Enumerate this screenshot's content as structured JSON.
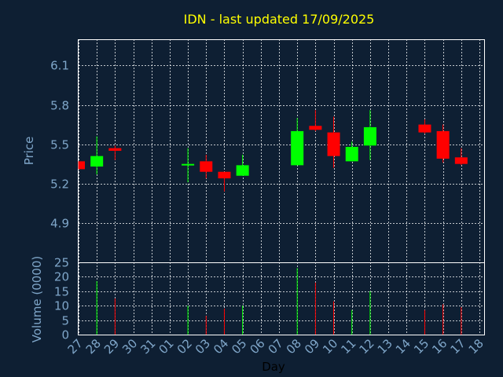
{
  "chart_data": {
    "type": "candlestick",
    "title": "IDN - last updated 17/09/2025",
    "ylabel_price": "Price",
    "ylabel_volume": "Volume (0000)",
    "xlabel": "Day",
    "price_ylim": [
      4.6,
      6.3
    ],
    "price_ticks": [
      "4.9",
      "5.2",
      "5.5",
      "5.8",
      "6.1"
    ],
    "volume_ylim": [
      0,
      25
    ],
    "volume_ticks": [
      "0",
      "5",
      "10",
      "15",
      "20",
      "25"
    ],
    "grid": true,
    "colors": {
      "up": "#00ff00",
      "down": "#ff0000",
      "background": "#0e1f33"
    },
    "days": [
      "27",
      "28",
      "29",
      "30",
      "31",
      "01",
      "02",
      "03",
      "04",
      "05",
      "06",
      "07",
      "08",
      "09",
      "10",
      "11",
      "12",
      "13",
      "14",
      "15",
      "16",
      "17",
      "18"
    ],
    "candles": [
      {
        "day": "27",
        "open": 5.37,
        "high": 5.37,
        "low": 5.31,
        "close": 5.31,
        "volume": 0
      },
      {
        "day": "28",
        "open": 5.33,
        "high": 5.56,
        "low": 5.27,
        "close": 5.41,
        "volume": 18.5
      },
      {
        "day": "29",
        "open": 5.47,
        "high": 5.49,
        "low": 5.38,
        "close": 5.45,
        "volume": 12.5
      },
      {
        "day": "02",
        "open": 5.34,
        "high": 5.47,
        "low": 5.21,
        "close": 5.35,
        "volume": 10
      },
      {
        "day": "03",
        "open": 5.37,
        "high": 5.42,
        "low": 5.24,
        "close": 5.29,
        "volume": 6.5
      },
      {
        "day": "04",
        "open": 5.29,
        "high": 5.29,
        "low": 5.14,
        "close": 5.24,
        "volume": 9
      },
      {
        "day": "05",
        "open": 5.26,
        "high": 5.42,
        "low": 5.26,
        "close": 5.34,
        "volume": 10
      },
      {
        "day": "08",
        "open": 5.34,
        "high": 5.7,
        "low": 5.34,
        "close": 5.6,
        "volume": 23
      },
      {
        "day": "09",
        "open": 5.64,
        "high": 5.76,
        "low": 5.6,
        "close": 5.61,
        "volume": 18
      },
      {
        "day": "10",
        "open": 5.59,
        "high": 5.71,
        "low": 5.32,
        "close": 5.41,
        "volume": 11.5
      },
      {
        "day": "11",
        "open": 5.37,
        "high": 5.52,
        "low": 5.37,
        "close": 5.48,
        "volume": 8.5
      },
      {
        "day": "12",
        "open": 5.49,
        "high": 5.76,
        "low": 5.38,
        "close": 5.63,
        "volume": 15
      },
      {
        "day": "15",
        "open": 5.65,
        "high": 5.69,
        "low": 5.58,
        "close": 5.59,
        "volume": 8.5
      },
      {
        "day": "16",
        "open": 5.6,
        "high": 5.65,
        "low": 5.36,
        "close": 5.39,
        "volume": 10.5
      },
      {
        "day": "17",
        "open": 5.4,
        "high": 5.47,
        "low": 5.34,
        "close": 5.35,
        "volume": 9.5
      }
    ]
  }
}
